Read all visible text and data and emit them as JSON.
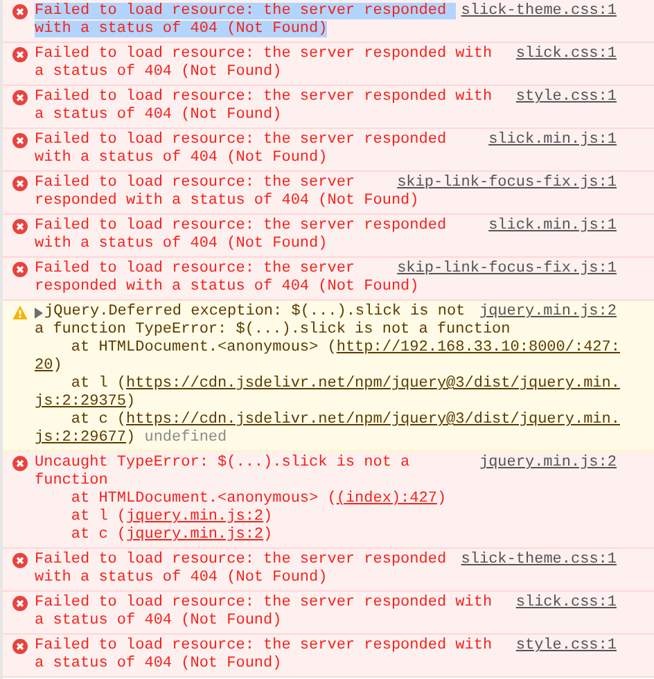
{
  "console": {
    "messages": [
      {
        "kind": "error",
        "selected": true,
        "source": "slick-theme.css:1",
        "lines": [
          [
            {
              "kind": "text",
              "text": "Failed to load resource: the server responded "
            }
          ],
          [
            {
              "kind": "text",
              "text": "with a status of 404 (Not Found)"
            }
          ]
        ]
      },
      {
        "kind": "error",
        "selected": false,
        "source": "slick.css:1",
        "lines": [
          [
            {
              "kind": "text",
              "text": "Failed to load resource: the server responded with"
            }
          ],
          [
            {
              "kind": "text",
              "text": "a status of 404 (Not Found)"
            }
          ]
        ]
      },
      {
        "kind": "error",
        "selected": false,
        "source": "style.css:1",
        "lines": [
          [
            {
              "kind": "text",
              "text": "Failed to load resource: the server responded with"
            }
          ],
          [
            {
              "kind": "text",
              "text": "a status of 404 (Not Found)"
            }
          ]
        ]
      },
      {
        "kind": "error",
        "selected": false,
        "source": "slick.min.js:1",
        "lines": [
          [
            {
              "kind": "text",
              "text": "Failed to load resource: the server responded"
            }
          ],
          [
            {
              "kind": "text",
              "text": "with a status of 404 (Not Found)"
            }
          ]
        ]
      },
      {
        "kind": "error",
        "selected": false,
        "source": "skip-link-focus-fix.js:1",
        "lines": [
          [
            {
              "kind": "text",
              "text": "Failed to load resource: the server"
            }
          ],
          [
            {
              "kind": "text",
              "text": "responded with a status of 404 (Not Found)"
            }
          ]
        ]
      },
      {
        "kind": "error",
        "selected": false,
        "source": "slick.min.js:1",
        "lines": [
          [
            {
              "kind": "text",
              "text": "Failed to load resource: the server responded"
            }
          ],
          [
            {
              "kind": "text",
              "text": "with a status of 404 (Not Found)"
            }
          ]
        ]
      },
      {
        "kind": "error",
        "selected": false,
        "source": "skip-link-focus-fix.js:1",
        "lines": [
          [
            {
              "kind": "text",
              "text": "Failed to load resource: the server"
            }
          ],
          [
            {
              "kind": "text",
              "text": "responded with a status of 404 (Not Found)"
            }
          ]
        ]
      },
      {
        "kind": "warning",
        "selected": false,
        "source": "jquery.min.js:2",
        "lines": [
          [
            {
              "kind": "text",
              "text": "jQuery.Deferred exception: $(...).slick is not"
            }
          ],
          [
            {
              "kind": "text",
              "text": "a function TypeError: $(...).slick is not a function"
            }
          ],
          [
            {
              "kind": "text",
              "text": "    at HTMLDocument.<anonymous> ("
            },
            {
              "kind": "link",
              "text": "http://192.168.33.10:8000/:427:"
            }
          ],
          [
            {
              "kind": "link",
              "text": "20"
            },
            {
              "kind": "text",
              "text": ")"
            }
          ],
          [
            {
              "kind": "text",
              "text": "    at l ("
            },
            {
              "kind": "link",
              "text": "https://cdn.jsdelivr.net/npm/jquery@3/dist/jquery.min."
            }
          ],
          [
            {
              "kind": "link",
              "text": "js:2:29375"
            },
            {
              "kind": "text",
              "text": ")"
            }
          ],
          [
            {
              "kind": "text",
              "text": "    at c ("
            },
            {
              "kind": "link",
              "text": "https://cdn.jsdelivr.net/npm/jquery@3/dist/jquery.min."
            }
          ],
          [
            {
              "kind": "link",
              "text": "js:2:29677"
            },
            {
              "kind": "text",
              "text": ") "
            },
            {
              "kind": "muted",
              "text": "undefined"
            }
          ]
        ]
      },
      {
        "kind": "error",
        "selected": false,
        "source": "jquery.min.js:2",
        "lines": [
          [
            {
              "kind": "text",
              "text": "Uncaught TypeError: $(...).slick is not a"
            }
          ],
          [
            {
              "kind": "text",
              "text": "function"
            }
          ],
          [
            {
              "kind": "text",
              "text": "    at HTMLDocument.<anonymous> ("
            },
            {
              "kind": "link",
              "text": "(index):427"
            },
            {
              "kind": "text",
              "text": ")"
            }
          ],
          [
            {
              "kind": "text",
              "text": "    at l ("
            },
            {
              "kind": "link",
              "text": "jquery.min.js:2"
            },
            {
              "kind": "text",
              "text": ")"
            }
          ],
          [
            {
              "kind": "text",
              "text": "    at c ("
            },
            {
              "kind": "link",
              "text": "jquery.min.js:2"
            },
            {
              "kind": "text",
              "text": ")"
            }
          ]
        ]
      },
      {
        "kind": "error",
        "selected": false,
        "source": "slick-theme.css:1",
        "lines": [
          [
            {
              "kind": "text",
              "text": "Failed to load resource: the server responded"
            }
          ],
          [
            {
              "kind": "text",
              "text": "with a status of 404 (Not Found)"
            }
          ]
        ]
      },
      {
        "kind": "error",
        "selected": false,
        "source": "slick.css:1",
        "lines": [
          [
            {
              "kind": "text",
              "text": "Failed to load resource: the server responded with"
            }
          ],
          [
            {
              "kind": "text",
              "text": "a status of 404 (Not Found)"
            }
          ]
        ]
      },
      {
        "kind": "error",
        "selected": false,
        "source": "style.css:1",
        "lines": [
          [
            {
              "kind": "text",
              "text": "Failed to load resource: the server responded with"
            }
          ],
          [
            {
              "kind": "text",
              "text": "a status of 404 (Not Found)"
            }
          ]
        ]
      }
    ]
  }
}
